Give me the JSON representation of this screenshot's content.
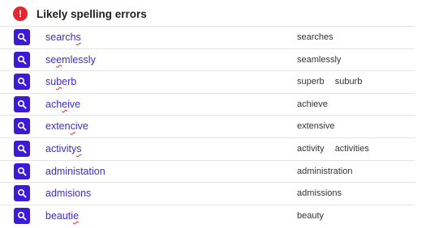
{
  "header": {
    "icon": "exclamation-icon",
    "alert_glyph": "!",
    "title": "Likely spelling errors",
    "alert_color": "#e3262f"
  },
  "accent_color": "#3b1bd6",
  "rows": [
    {
      "word_before": "search",
      "word_error": "s",
      "word_after": "",
      "suggestions": [
        "searches"
      ]
    },
    {
      "word_before": "se",
      "word_error": "e",
      "word_after": "mlessly",
      "suggestions": [
        "seamlessly"
      ]
    },
    {
      "word_before": "su",
      "word_error": "b",
      "word_after": "erb",
      "suggestions": [
        "superb",
        "suburb"
      ]
    },
    {
      "word_before": "ach",
      "word_error": "e",
      "word_after": "ive",
      "suggestions": [
        "achieve"
      ]
    },
    {
      "word_before": "exten",
      "word_error": "c",
      "word_after": "ive",
      "suggestions": [
        "extensive"
      ]
    },
    {
      "word_before": "activity",
      "word_error": "s",
      "word_after": "",
      "suggestions": [
        "activity",
        "activities"
      ]
    },
    {
      "word_before": "administation",
      "word_error": "",
      "word_after": "",
      "suggestions": [
        "administration"
      ]
    },
    {
      "word_before": "admisions",
      "word_error": "",
      "word_after": "",
      "suggestions": [
        "admissions"
      ]
    },
    {
      "word_before": "beauti",
      "word_error": "e",
      "word_after": "",
      "suggestions": [
        "beauty"
      ]
    }
  ]
}
